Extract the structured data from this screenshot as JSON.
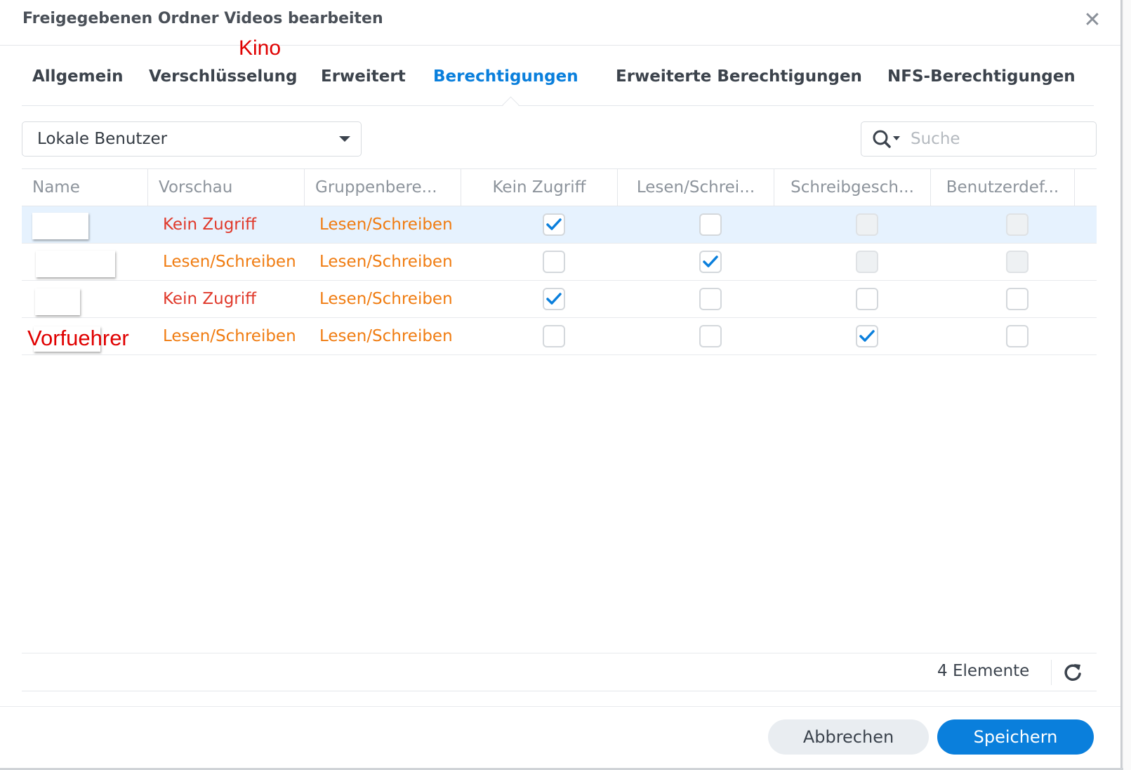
{
  "dialog": {
    "title": "Freigegebenen Ordner Videos bearbeiten",
    "close_label": "✕"
  },
  "annotations": {
    "kino": "Kino",
    "vorfuehrer": "Vorfuehrer"
  },
  "tabs": [
    {
      "label": "Allgemein",
      "active": false
    },
    {
      "label": "Verschlüsselung",
      "active": false
    },
    {
      "label": "Erweitert",
      "active": false
    },
    {
      "label": "Berechtigungen",
      "active": true
    },
    {
      "label": "Erweiterte Berechtigungen",
      "active": false
    },
    {
      "label": "NFS-Berechtigungen",
      "active": false
    }
  ],
  "user_type_select": {
    "value": "Lokale Benutzer"
  },
  "search": {
    "placeholder": "Suche",
    "value": ""
  },
  "table": {
    "columns": [
      "Name",
      "Vorschau",
      "Gruppenbere...",
      "Kein Zugriff",
      "Lesen/Schrei...",
      "Schreibgesch...",
      "Benutzerdef..."
    ],
    "rows": [
      {
        "name": "",
        "preview": "Kein Zugriff",
        "group": "Lesen/Schreiben",
        "selected": true,
        "no_access": true,
        "read_write": false,
        "read_only": false,
        "custom": false
      },
      {
        "name": "",
        "preview": "Lesen/Schreiben",
        "group": "Lesen/Schreiben",
        "selected": false,
        "no_access": false,
        "read_write": true,
        "read_only": false,
        "custom": false
      },
      {
        "name": "",
        "preview": "Kein Zugriff",
        "group": "Lesen/Schreiben",
        "selected": false,
        "no_access": true,
        "read_write": false,
        "read_only": false,
        "custom": false
      },
      {
        "name": "",
        "preview": "Lesen/Schreiben",
        "group": "Lesen/Schreiben",
        "selected": false,
        "no_access": false,
        "read_write": false,
        "read_only": true,
        "custom": false
      }
    ]
  },
  "footer": {
    "count": "4 Elemente"
  },
  "buttons": {
    "cancel": "Abbrechen",
    "save": "Speichern"
  },
  "colors": {
    "accent": "#0a7fdc",
    "perm_no_access": "#e0392b",
    "perm_read_write": "#f07c11",
    "row_selected": "#e6f2fe",
    "annotation": "#e00000"
  }
}
